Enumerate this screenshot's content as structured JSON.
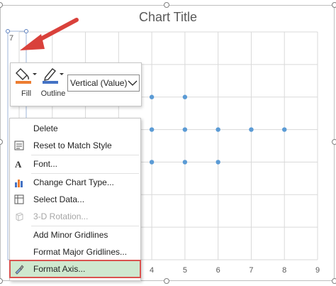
{
  "chart": {
    "title": "Chart Title",
    "x_ticks": [
      "4",
      "5",
      "6",
      "7",
      "8",
      "9"
    ],
    "y_tick_top": "7",
    "marker_color": "#5b9bd5"
  },
  "chart_data": {
    "type": "scatter",
    "title": "Chart Title",
    "xlabel": "",
    "ylabel": "",
    "series": [
      {
        "x": [
          4,
          5
        ],
        "y": [
          5,
          5
        ]
      },
      {
        "x": [
          4,
          5,
          6,
          7,
          8
        ],
        "y": [
          4,
          4,
          4,
          4,
          4
        ]
      },
      {
        "x": [
          4,
          5,
          6
        ],
        "y": [
          3,
          3,
          3
        ]
      }
    ],
    "grid": true
  },
  "mini_toolbar": {
    "fill_label": "Fill",
    "outline_label": "Outline",
    "selection_value": "Vertical (Value)",
    "fill_color": "#ed7d31",
    "outline_color": "#4472c4"
  },
  "context_menu": {
    "items": [
      {
        "label": "Delete",
        "icon": "none"
      },
      {
        "label": "Reset to Match Style",
        "icon": "reset-style-icon"
      },
      {
        "label": "Font...",
        "icon": "font-icon"
      },
      {
        "label": "Change Chart Type...",
        "icon": "chart-type-icon"
      },
      {
        "label": "Select Data...",
        "icon": "select-data-icon"
      },
      {
        "label": "3-D Rotation...",
        "icon": "3d-rotation-icon",
        "disabled": true
      },
      {
        "label": "Add Minor Gridlines",
        "icon": "none"
      },
      {
        "label": "Format Major Gridlines...",
        "icon": "none"
      },
      {
        "label": "Format Axis...",
        "icon": "format-axis-icon",
        "highlighted": true
      }
    ]
  },
  "annotation": {
    "arrow_color": "#d9413b",
    "highlight_border": "#d9534f"
  }
}
